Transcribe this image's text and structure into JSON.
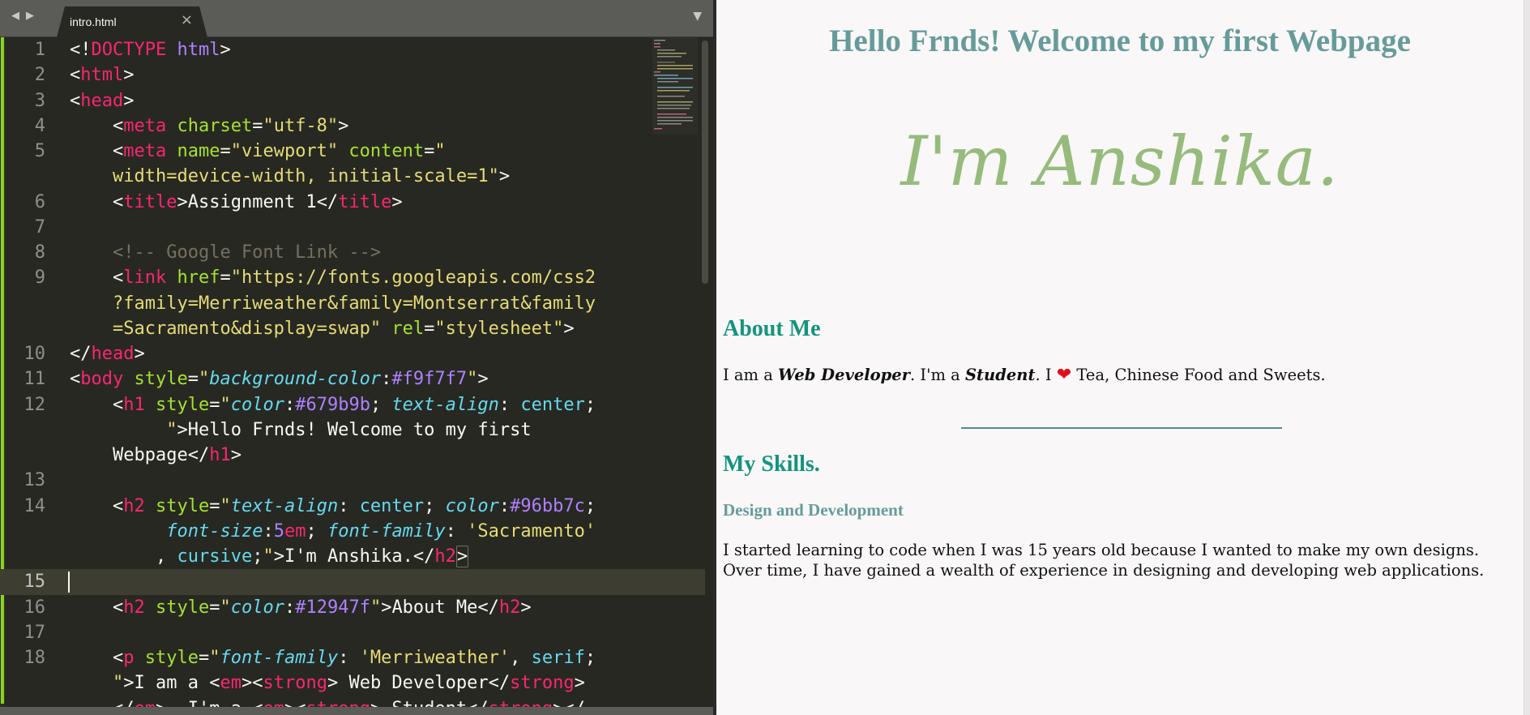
{
  "editor": {
    "tab": {
      "title": "intro.html",
      "close_glyph": "×"
    },
    "nav": {
      "back_glyph": "◀",
      "forward_glyph": "▶",
      "dropdown_glyph": "▼"
    },
    "current_line": 15,
    "lines": [
      {
        "n": "1",
        "indent": 0,
        "tokens": [
          [
            "<!",
            "pun"
          ],
          [
            "DOCTYPE",
            "doc"
          ],
          [
            " ",
            "txt"
          ],
          [
            "html",
            "kw"
          ],
          [
            ">",
            "pun"
          ]
        ]
      },
      {
        "n": "2",
        "indent": 0,
        "tokens": [
          [
            "<",
            "pun"
          ],
          [
            "html",
            "tag"
          ],
          [
            ">",
            "pun"
          ]
        ]
      },
      {
        "n": "3",
        "indent": 0,
        "tokens": [
          [
            "<",
            "pun"
          ],
          [
            "head",
            "tag"
          ],
          [
            ">",
            "pun"
          ]
        ]
      },
      {
        "n": "4",
        "indent": 4,
        "tokens": [
          [
            "<",
            "pun"
          ],
          [
            "meta",
            "tag"
          ],
          [
            " ",
            "txt"
          ],
          [
            "charset",
            "attr"
          ],
          [
            "=",
            "pun"
          ],
          [
            "\"utf-8\"",
            "str"
          ],
          [
            ">",
            "pun"
          ]
        ]
      },
      {
        "n": "5",
        "indent": 4,
        "tokens": [
          [
            "<",
            "pun"
          ],
          [
            "meta",
            "tag"
          ],
          [
            " ",
            "txt"
          ],
          [
            "name",
            "attr"
          ],
          [
            "=",
            "pun"
          ],
          [
            "\"viewport\"",
            "str"
          ],
          [
            " ",
            "txt"
          ],
          [
            "content",
            "attr"
          ],
          [
            "=",
            "pun"
          ],
          [
            "\"",
            "str"
          ]
        ]
      },
      {
        "n": "",
        "indent": 4,
        "tokens": [
          [
            "width=device-width, initial-scale=1\"",
            "str"
          ],
          [
            ">",
            "pun"
          ]
        ]
      },
      {
        "n": "6",
        "indent": 4,
        "tokens": [
          [
            "<",
            "pun"
          ],
          [
            "title",
            "tag"
          ],
          [
            ">",
            "pun"
          ],
          [
            "Assignment 1",
            "txt"
          ],
          [
            "</",
            "pun"
          ],
          [
            "title",
            "tag"
          ],
          [
            ">",
            "pun"
          ]
        ]
      },
      {
        "n": "7",
        "indent": 0,
        "tokens": []
      },
      {
        "n": "8",
        "indent": 4,
        "tokens": [
          [
            "<!-- Google Font Link -->",
            "com"
          ]
        ]
      },
      {
        "n": "9",
        "indent": 4,
        "tokens": [
          [
            "<",
            "pun"
          ],
          [
            "link",
            "tag"
          ],
          [
            " ",
            "txt"
          ],
          [
            "href",
            "attr"
          ],
          [
            "=",
            "pun"
          ],
          [
            "\"https://fonts.googleapis.com/css2",
            "str"
          ]
        ]
      },
      {
        "n": "",
        "indent": 4,
        "tokens": [
          [
            "?family=Merriweather&family=Montserrat&family",
            "str"
          ]
        ]
      },
      {
        "n": "",
        "indent": 4,
        "tokens": [
          [
            "=Sacramento&display=swap\"",
            "str"
          ],
          [
            " ",
            "txt"
          ],
          [
            "rel",
            "attr"
          ],
          [
            "=",
            "pun"
          ],
          [
            "\"stylesheet\"",
            "str"
          ],
          [
            ">",
            "pun"
          ]
        ]
      },
      {
        "n": "10",
        "indent": 0,
        "tokens": [
          [
            "</",
            "pun"
          ],
          [
            "head",
            "tag"
          ],
          [
            ">",
            "pun"
          ]
        ]
      },
      {
        "n": "11",
        "indent": 0,
        "tokens": [
          [
            "<",
            "pun"
          ],
          [
            "body",
            "tag"
          ],
          [
            " ",
            "txt"
          ],
          [
            "style",
            "attr"
          ],
          [
            "=",
            "pun"
          ],
          [
            "\"",
            "str"
          ],
          [
            "background-color",
            "prop"
          ],
          [
            ":",
            "pun"
          ],
          [
            "#f9f7f7",
            "num"
          ],
          [
            "\"",
            "str"
          ],
          [
            ">",
            "pun"
          ]
        ]
      },
      {
        "n": "12",
        "indent": 4,
        "tokens": [
          [
            "<",
            "pun"
          ],
          [
            "h1",
            "tag"
          ],
          [
            " ",
            "txt"
          ],
          [
            "style",
            "attr"
          ],
          [
            "=",
            "pun"
          ],
          [
            "\"",
            "str"
          ],
          [
            "color",
            "prop"
          ],
          [
            ":",
            "pun"
          ],
          [
            "#679b9b",
            "num"
          ],
          [
            "; ",
            "pun"
          ],
          [
            "text-align",
            "prop"
          ],
          [
            ": ",
            "pun"
          ],
          [
            "center",
            "val"
          ],
          [
            ";",
            "pun"
          ]
        ]
      },
      {
        "n": "",
        "indent": 9,
        "tokens": [
          [
            "\"",
            "str"
          ],
          [
            ">",
            "pun"
          ],
          [
            "Hello Frnds! Welcome to my first",
            "txt"
          ]
        ]
      },
      {
        "n": "",
        "indent": 4,
        "tokens": [
          [
            "Webpage",
            "txt"
          ],
          [
            "</",
            "pun"
          ],
          [
            "h1",
            "tag"
          ],
          [
            ">",
            "pun"
          ]
        ]
      },
      {
        "n": "13",
        "indent": 0,
        "tokens": []
      },
      {
        "n": "14",
        "indent": 4,
        "tokens": [
          [
            "<",
            "pun"
          ],
          [
            "h2",
            "tag"
          ],
          [
            " ",
            "txt"
          ],
          [
            "style",
            "attr"
          ],
          [
            "=",
            "pun"
          ],
          [
            "\"",
            "str"
          ],
          [
            "text-align",
            "prop"
          ],
          [
            ": ",
            "pun"
          ],
          [
            "center",
            "val"
          ],
          [
            "; ",
            "pun"
          ],
          [
            "color",
            "prop"
          ],
          [
            ":",
            "pun"
          ],
          [
            "#96bb7c",
            "num"
          ],
          [
            ";",
            "pun"
          ]
        ]
      },
      {
        "n": "",
        "indent": 9,
        "tokens": [
          [
            "font-size",
            "prop"
          ],
          [
            ":",
            "pun"
          ],
          [
            "5",
            "num"
          ],
          [
            "em",
            "tag"
          ],
          [
            "; ",
            "pun"
          ],
          [
            "font-family",
            "prop"
          ],
          [
            ": ",
            "pun"
          ],
          [
            "'Sacramento'",
            "str"
          ]
        ]
      },
      {
        "n": "",
        "indent": 8,
        "tokens": [
          [
            ", ",
            "pun"
          ],
          [
            "cursive",
            "val"
          ],
          [
            ";",
            "pun"
          ],
          [
            "\"",
            "str"
          ],
          [
            ">",
            "pun"
          ],
          [
            "I'm Anshika.",
            "txt"
          ],
          [
            "</",
            "pun"
          ],
          [
            "h2",
            "tag"
          ],
          [
            ">",
            "bra"
          ]
        ]
      },
      {
        "n": "15",
        "indent": 0,
        "tokens": []
      },
      {
        "n": "16",
        "indent": 4,
        "tokens": [
          [
            "<",
            "pun"
          ],
          [
            "h2",
            "tag"
          ],
          [
            " ",
            "txt"
          ],
          [
            "style",
            "attr"
          ],
          [
            "=",
            "pun"
          ],
          [
            "\"",
            "str"
          ],
          [
            "color",
            "prop"
          ],
          [
            ":",
            "pun"
          ],
          [
            "#12947f",
            "num"
          ],
          [
            "\"",
            "str"
          ],
          [
            ">",
            "pun"
          ],
          [
            "About Me",
            "txt"
          ],
          [
            "</",
            "pun"
          ],
          [
            "h2",
            "tag"
          ],
          [
            ">",
            "pun"
          ]
        ]
      },
      {
        "n": "17",
        "indent": 0,
        "tokens": []
      },
      {
        "n": "18",
        "indent": 4,
        "tokens": [
          [
            "<",
            "pun"
          ],
          [
            "p",
            "tag"
          ],
          [
            " ",
            "txt"
          ],
          [
            "style",
            "attr"
          ],
          [
            "=",
            "pun"
          ],
          [
            "\"",
            "str"
          ],
          [
            "font-family",
            "prop"
          ],
          [
            ": ",
            "pun"
          ],
          [
            "'Merriweather'",
            "str"
          ],
          [
            ", ",
            "pun"
          ],
          [
            "serif",
            "val"
          ],
          [
            ";",
            "pun"
          ]
        ]
      },
      {
        "n": "",
        "indent": 4,
        "tokens": [
          [
            "\"",
            "str"
          ],
          [
            ">",
            "pun"
          ],
          [
            "I am a ",
            "txt"
          ],
          [
            "<",
            "pun"
          ],
          [
            "em",
            "tag"
          ],
          [
            "><",
            "pun"
          ],
          [
            "strong",
            "tag"
          ],
          [
            ">",
            "pun"
          ],
          [
            " Web Developer",
            "txt"
          ],
          [
            "</",
            "pun"
          ],
          [
            "strong",
            "tag"
          ],
          [
            ">",
            "pun"
          ]
        ]
      },
      {
        "n": "",
        "indent": 4,
        "tokens": [
          [
            "</",
            "pun"
          ],
          [
            "em",
            "tag"
          ],
          [
            ">",
            "pun"
          ],
          [
            ". I'm a ",
            "txt"
          ],
          [
            "<",
            "pun"
          ],
          [
            "em",
            "tag"
          ],
          [
            "><",
            "pun"
          ],
          [
            "strong",
            "tag"
          ],
          [
            ">",
            "pun"
          ],
          [
            " Student",
            "txt"
          ],
          [
            "</",
            "pun"
          ],
          [
            "strong",
            "tag"
          ],
          [
            "></",
            "pun"
          ]
        ]
      }
    ]
  },
  "preview": {
    "h1": "Hello Frnds! Welcome to my first Webpage",
    "name": "I'm Anshika.",
    "about_heading": "About Me",
    "about": {
      "p1": "I am a ",
      "em1": "Web Developer",
      "p2": ". I'm a ",
      "em2": "Student",
      "p3": ". I ",
      "heart": "❤",
      "p4": " Tea, Chinese Food and Sweets."
    },
    "skills_heading": "My Skills.",
    "skills_subheading": "Design and Development",
    "skills_paragraph": "I started learning to code when I was 15 years old because I wanted to make my own designs. Over time, I have gained a wealth of experience in designing and developing web applications."
  },
  "colors": {
    "editor_bg": "#272822",
    "preview_bg": "#f9f7f7",
    "h1": "#679b9b",
    "name": "#96bb7c",
    "h2": "#12947f",
    "gutter_modified": "#8bd41e"
  }
}
